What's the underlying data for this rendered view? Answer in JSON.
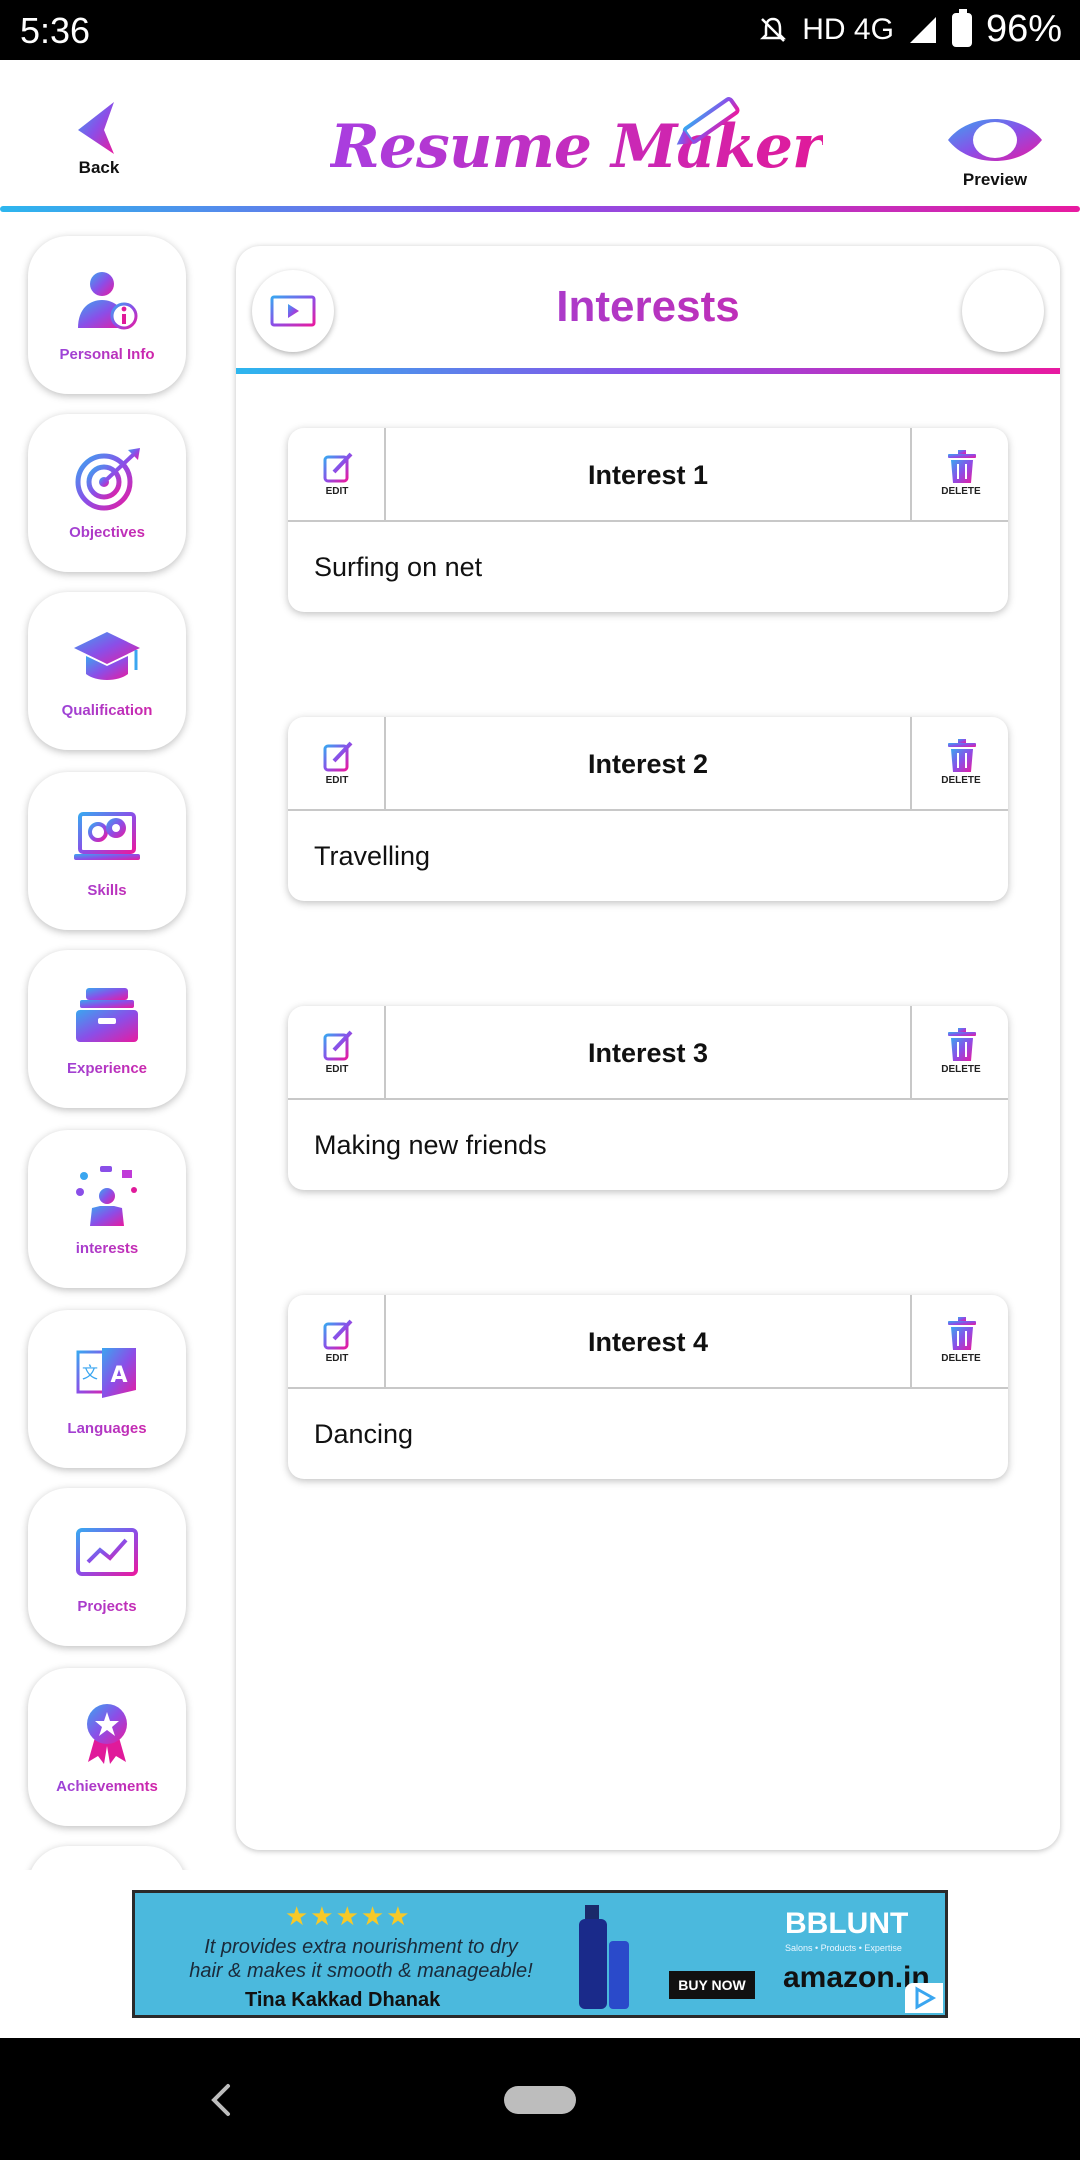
{
  "status_bar": {
    "time": "5:36",
    "network": "HD 4G",
    "battery": "96%"
  },
  "header": {
    "back_label": "Back",
    "logo_text": "Resume Maker",
    "preview_label": "Preview"
  },
  "sidebar": {
    "items": [
      {
        "label": "Personal Info",
        "icon": "person-info-icon"
      },
      {
        "label": "Objectives",
        "icon": "target-icon"
      },
      {
        "label": "Qualification",
        "icon": "graduation-cap-icon"
      },
      {
        "label": "Skills",
        "icon": "gears-laptop-icon"
      },
      {
        "label": "Experience",
        "icon": "briefcase-box-icon"
      },
      {
        "label": "interests",
        "icon": "juggling-person-icon"
      },
      {
        "label": "Languages",
        "icon": "translate-icon"
      },
      {
        "label": "Projects",
        "icon": "chart-board-icon"
      },
      {
        "label": "Achievements",
        "icon": "award-ribbon-icon"
      }
    ]
  },
  "panel": {
    "title": "Interests",
    "edit_label": "EDIT",
    "delete_label": "DELETE",
    "interests": [
      {
        "title": "Interest 1",
        "value": "Surfing on net"
      },
      {
        "title": "Interest 2",
        "value": "Travelling"
      },
      {
        "title": "Interest 3",
        "value": "Making new friends"
      },
      {
        "title": "Interest 4",
        "value": "Dancing"
      }
    ]
  },
  "ad": {
    "stars": "★★★★★",
    "line1": "It provides extra nourishment to dry",
    "line2": "hair & makes it smooth & manageable!",
    "author": "Tina Kakkad Dhanak",
    "buy_label": "BUY NOW",
    "brand": "BBLUNT",
    "brand_sub": "Salons • Products • Expertise",
    "store": "amazon.in"
  },
  "colors": {
    "gradient_start": "#2db6ee",
    "gradient_mid": "#8a4fe8",
    "gradient_end": "#e81aa0"
  }
}
